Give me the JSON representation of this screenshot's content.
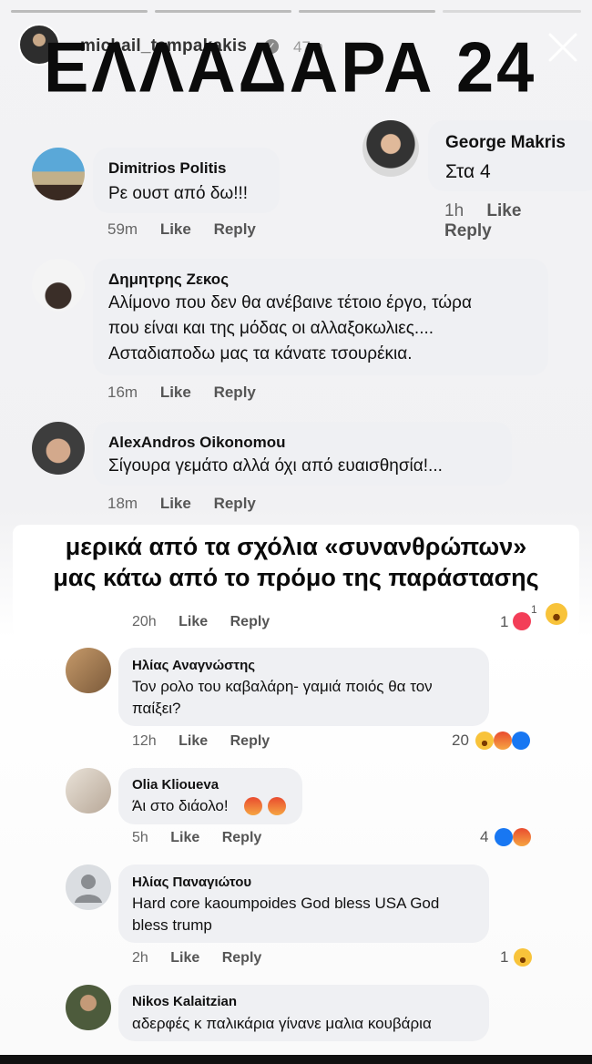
{
  "story": {
    "username": "michail_tampakakis",
    "time": "47m",
    "headline": "ΕΛΛΑΔΑΡΑ 24",
    "overlay_line1": "μερικά από τα σχόλια «συνανθρώπων»",
    "overlay_line2": "μας κάτω από το πρόμο της παράστασης"
  },
  "labels": {
    "like": "Like",
    "reply": "Reply"
  },
  "comments": {
    "george": {
      "author": "George Makris",
      "text": "Στα 4",
      "time": "1h"
    },
    "dimitrios": {
      "author": "Dimitrios Politis",
      "text": "Ρε ουστ από δω!!!",
      "time": "59m"
    },
    "zekos": {
      "author": "Δημητρης Ζεκος",
      "line1": "Αλίμονο που δεν θα ανέβαινε τέτοιο έργο, τώρα",
      "line2": "που είναι και της μόδας οι αλλαξοκωλιες....",
      "line3": "Ασταδιαποδω μας τα κάνατε τσουρέκια.",
      "time": "16m"
    },
    "alex": {
      "author": "AlexAndros Oikonomou",
      "text": "Σίγουρα γεμάτο αλλά όχι από ευαισθησία!...",
      "time": "18m"
    },
    "hidden": {
      "time": "20h",
      "count": "1",
      "sup": "1"
    },
    "ilias_a": {
      "author": "Ηλίας Αναγνώστης",
      "line1": "Τον ρολο του καβαλάρη- γαμιά ποιός θα τον",
      "line2": "παίξει?",
      "time": "12h",
      "count": "20"
    },
    "olia": {
      "author": "Olia Klioueva",
      "text": "Άι στο διάολο!",
      "time": "5h",
      "count": "4"
    },
    "ilias_p": {
      "author": "Ηλίας Παναγιώτου",
      "line1": "Hard core kaoumpoides God bless USA God",
      "line2": "bless trump",
      "time": "2h",
      "count": "1"
    },
    "nikos": {
      "author": "Nikos Kalaitzian",
      "text": "αδερφές κ παλικάρια γίνανε μαλια κουβάρια"
    }
  },
  "colors": {
    "like_blue": "#1877f2",
    "bubble_bg": "#eff0f3"
  }
}
